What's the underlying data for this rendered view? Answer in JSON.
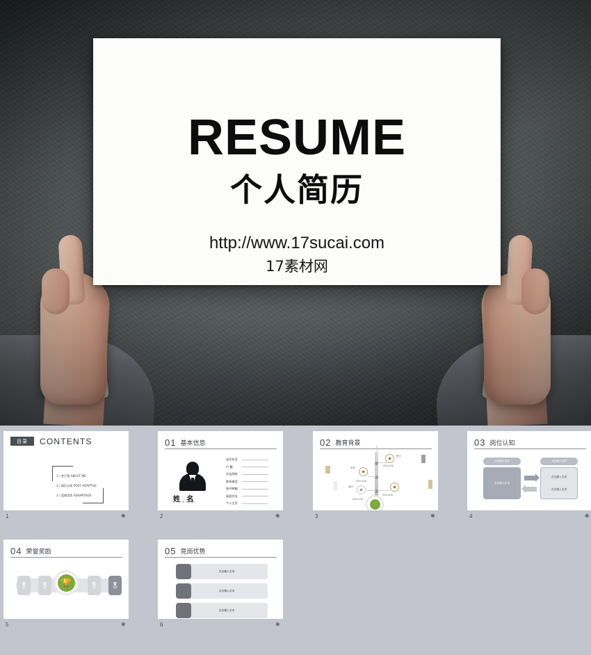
{
  "hero": {
    "title": "RESUME",
    "subtitle": "个人简历",
    "url": "http://www.17sucai.com",
    "brand": "17素材网"
  },
  "thumbnails": [
    {
      "page": "1",
      "star": "✹",
      "kind": "contents",
      "badge": "目录",
      "heading": "CONTENTS",
      "items": [
        "1 / 关于我 ABOUT ME",
        "2 / 岗位认知 POST ADAPTIVE",
        "3 / 竞岗优势 ADVANTAGE"
      ]
    },
    {
      "page": "2",
      "star": "✹",
      "kind": "basic-info",
      "num": "01",
      "title": "基本信息",
      "name": "姓 名",
      "name_sub": "YOUR NAME",
      "fields": [
        "出生年月",
        "户  籍",
        "毕业院校",
        "联系电话",
        "电子邮箱",
        "现居住址",
        "个人主页"
      ]
    },
    {
      "page": "3",
      "star": "✹",
      "kind": "education",
      "num": "02",
      "title": "教育背景",
      "years": [
        "200-200",
        "200-200",
        "200-200"
      ],
      "nodes": [
        "硕士",
        "本科",
        "高中"
      ]
    },
    {
      "page": "4",
      "star": "✹",
      "kind": "cognition",
      "num": "03",
      "title": "岗位认知",
      "pill_left": "点击输入文本",
      "pill_right": "点击输入文本",
      "box_left": "点击输入文本",
      "box_right_items": [
        "点击输入文本",
        "点击输入文本"
      ]
    },
    {
      "page": "5",
      "star": "✹",
      "kind": "honors",
      "num": "04",
      "title": "荣誉奖励",
      "medals": [
        "🎖",
        "🎖",
        "🎖",
        "🎖"
      ],
      "trophy": "🏆"
    },
    {
      "page": "6",
      "star": "✹",
      "kind": "advantage",
      "num": "05",
      "title": "竞岗优势",
      "rows": [
        "点击输入文本",
        "点击输入文本",
        "点击输入文本"
      ]
    }
  ],
  "colors": {
    "canvas": "#c2c5ce",
    "accent_green": "#7fa83e",
    "wall_dark": "#3a3e40",
    "board": "#fcfcfa"
  }
}
